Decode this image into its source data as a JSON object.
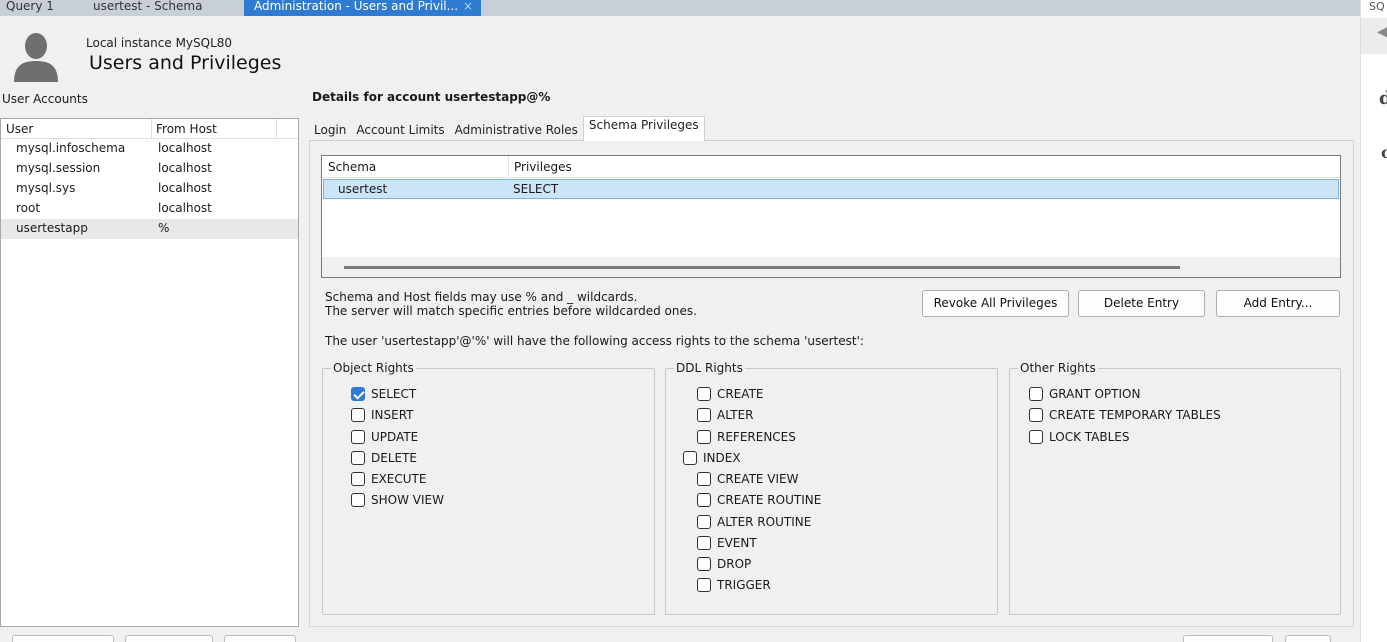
{
  "tabs": [
    {
      "label": "Query 1"
    },
    {
      "label": "usertest - Schema"
    },
    {
      "label": "Administration - Users and Privil...",
      "close": "×"
    }
  ],
  "right_strip": {
    "sq": "SQ",
    "arrow": "◀",
    "d": "d",
    "c": "c"
  },
  "header": {
    "instance": "Local instance MySQL80",
    "title": "Users and Privileges"
  },
  "accounts": {
    "label": "User Accounts",
    "columns": [
      "User",
      "From Host"
    ],
    "rows": [
      {
        "user": "mysql.infoschema",
        "host": "localhost"
      },
      {
        "user": "mysql.session",
        "host": "localhost"
      },
      {
        "user": "mysql.sys",
        "host": "localhost"
      },
      {
        "user": "root",
        "host": "localhost"
      },
      {
        "user": "usertestapp",
        "host": "%"
      }
    ]
  },
  "details": {
    "title": "Details for account usertestapp@%",
    "tabs": [
      "Login",
      "Account Limits",
      "Administrative Roles",
      "Schema Privileges"
    ],
    "schema_grid": {
      "columns": [
        "Schema",
        "Privileges"
      ],
      "rows": [
        {
          "schema": "usertest",
          "privileges": "SELECT"
        }
      ]
    },
    "hint_line1": "Schema and Host fields may use % and _ wildcards.",
    "hint_line2": "The server will match specific entries before wildcarded ones.",
    "buttons": {
      "revoke": "Revoke All Privileges",
      "delete": "Delete Entry",
      "add": "Add Entry..."
    },
    "access_line": "The user 'usertestapp'@'%' will have the following access rights to the schema 'usertest':",
    "object_rights": {
      "legend": "Object Rights",
      "items": [
        "SELECT",
        "INSERT",
        "UPDATE",
        "DELETE",
        "EXECUTE",
        "SHOW VIEW"
      ],
      "checked": [
        true,
        false,
        false,
        false,
        false,
        false
      ]
    },
    "ddl_rights": {
      "legend": "DDL Rights",
      "items": [
        "CREATE",
        "ALTER",
        "REFERENCES",
        "INDEX",
        "CREATE VIEW",
        "CREATE ROUTINE",
        "ALTER ROUTINE",
        "EVENT",
        "DROP",
        "TRIGGER"
      ]
    },
    "other_rights": {
      "legend": "Other Rights",
      "items": [
        "GRANT OPTION",
        "CREATE TEMPORARY TABLES",
        "LOCK TABLES"
      ]
    }
  },
  "colors": {
    "accent": "#2f7bd2",
    "selection": "#cce4f7"
  }
}
